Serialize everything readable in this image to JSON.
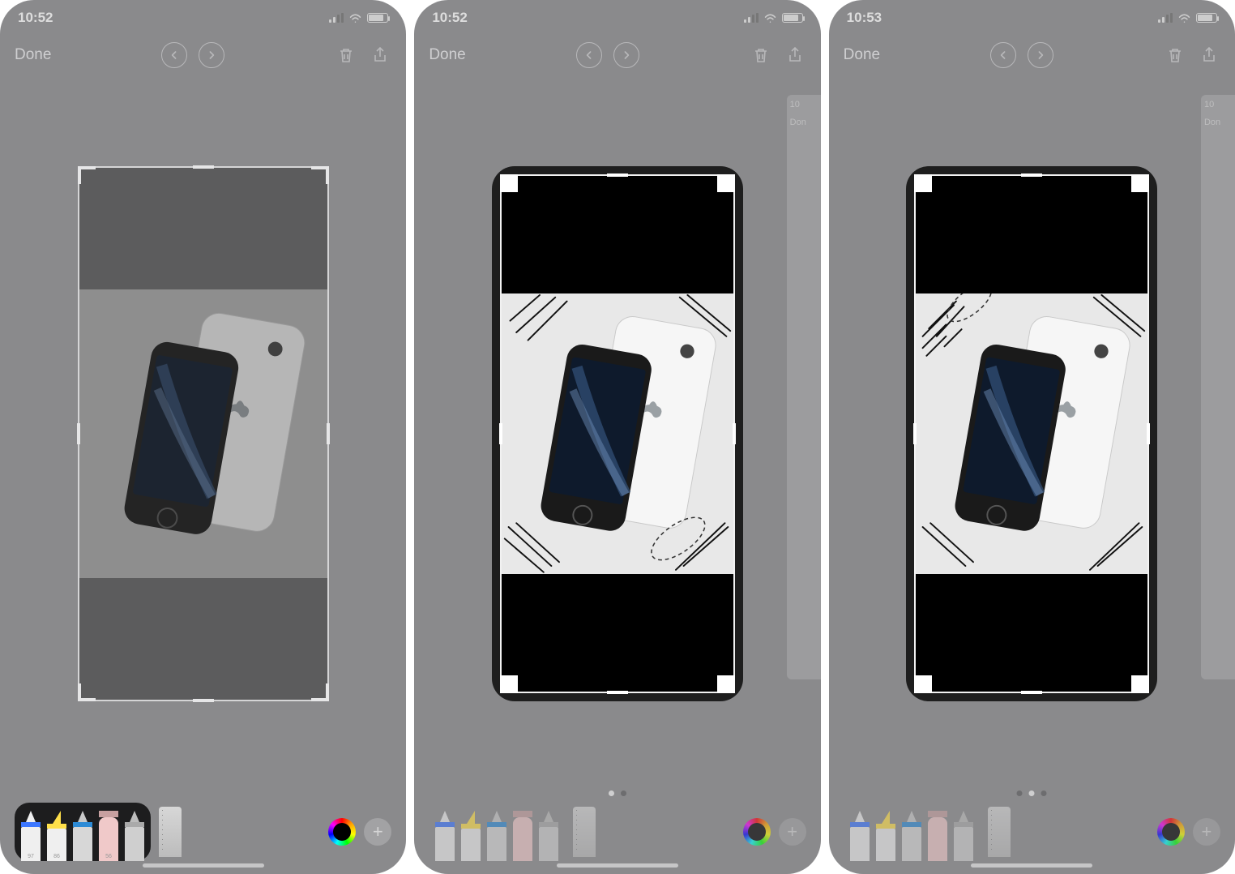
{
  "screens": [
    {
      "time": "10:52",
      "done": "Done",
      "selected_tool_group": true,
      "page_dots": 0,
      "has_scribbles": false,
      "has_lasso": false,
      "has_lasso_top": false,
      "dim_canvas": true,
      "peek": null
    },
    {
      "time": "10:52",
      "done": "Done",
      "selected_tool_group": false,
      "page_dots": 2,
      "active_dot": 0,
      "has_scribbles": true,
      "has_lasso": true,
      "has_lasso_top": false,
      "dim_canvas": false,
      "peek": {
        "time": "10",
        "done": "Don"
      }
    },
    {
      "time": "10:53",
      "done": "Done",
      "selected_tool_group": false,
      "page_dots": 3,
      "active_dot": 1,
      "has_scribbles": true,
      "has_lasso": false,
      "has_lasso_top": true,
      "dim_canvas": false,
      "peek": {
        "time": "10",
        "done": "Don"
      }
    }
  ],
  "tools": {
    "pen_labels": [
      "97",
      "86",
      "",
      "56",
      ""
    ]
  },
  "icons": {
    "undo": "undo-icon",
    "redo": "redo-icon",
    "trash": "trash-icon",
    "share": "share-icon"
  }
}
